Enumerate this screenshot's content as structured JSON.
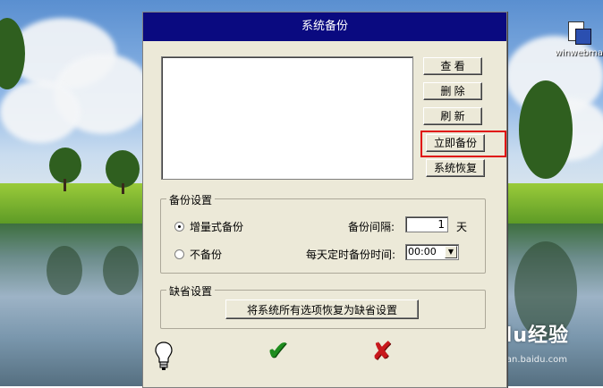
{
  "desktop": {
    "icon_label": "winwebmai",
    "watermark_text": "Baidu经验",
    "watermark_url": "jingyan.baidu.com"
  },
  "dialog": {
    "title": "系统备份",
    "buttons": {
      "view": "查 看",
      "delete": "删 除",
      "refresh": "刷 新",
      "backup_now": "立即备份",
      "restore": "系统恢复"
    },
    "highlight_color": "#e01010",
    "backup_settings": {
      "legend": "备份设置",
      "incremental_label": "增量式备份",
      "none_label": "不备份",
      "selected": "incremental",
      "interval_label": "备份间隔:",
      "interval_value": "1",
      "interval_unit": "天",
      "daily_time_label": "每天定时备份时间:",
      "daily_time_value": "00:00"
    },
    "default_settings": {
      "legend": "缺省设置",
      "restore_defaults_label": "将系统所有选项恢复为缺省设置"
    },
    "footer": {
      "help_icon": "lightbulb-icon",
      "ok_icon": "checkmark-icon",
      "cancel_icon": "cross-icon"
    },
    "titlebar_color": "#0a0a80"
  }
}
